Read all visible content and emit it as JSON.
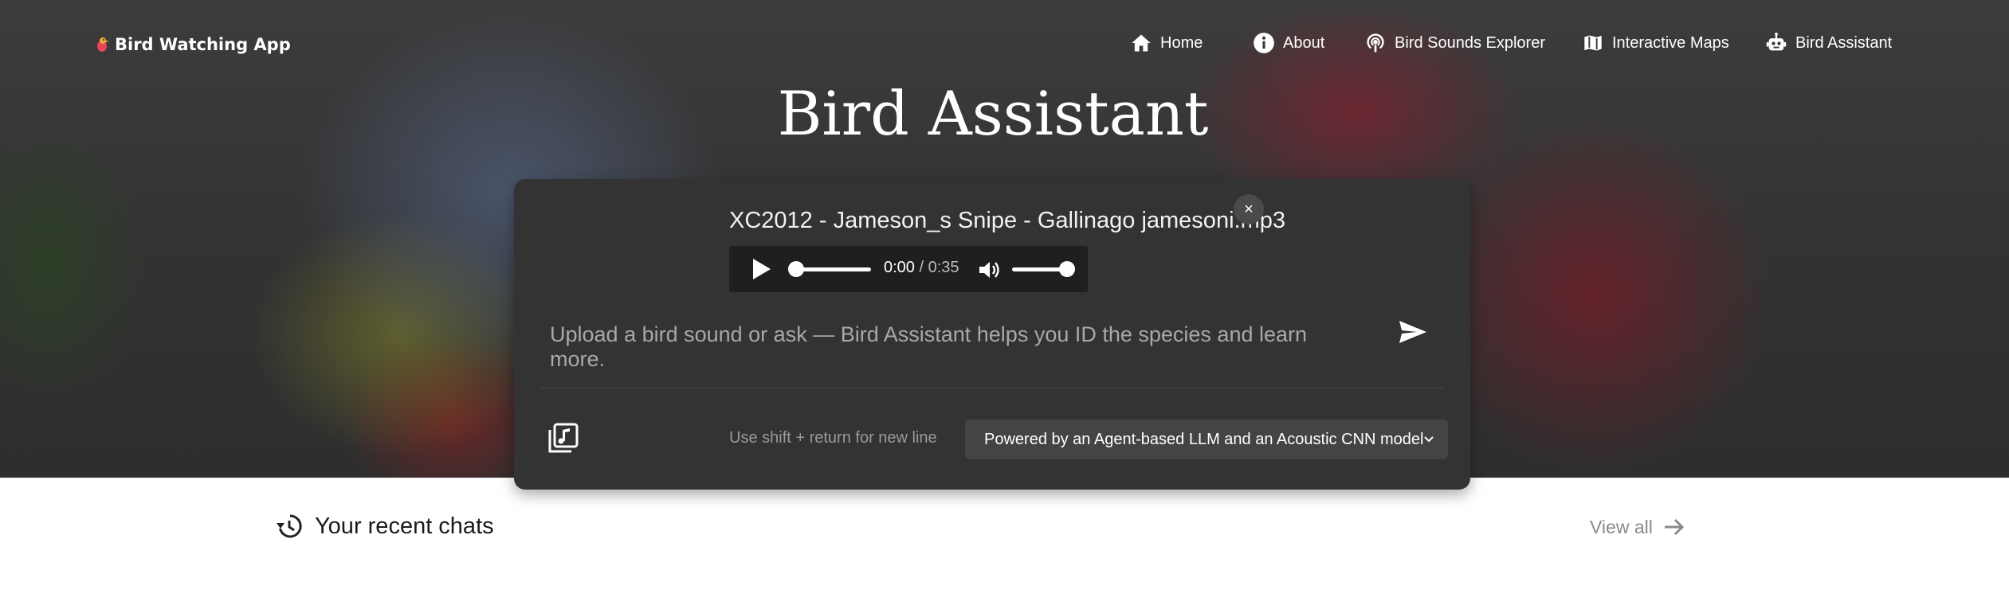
{
  "brand": {
    "name": "Bird Watching App",
    "icon": "bird-logo-icon"
  },
  "nav": [
    {
      "label": "Home",
      "icon": "home-icon"
    },
    {
      "label": "About",
      "icon": "info-icon"
    },
    {
      "label": "Bird Sounds Explorer",
      "icon": "podcast-icon"
    },
    {
      "label": "Interactive Maps",
      "icon": "map-icon"
    },
    {
      "label": "Bird Assistant",
      "icon": "robot-icon"
    }
  ],
  "page_title": "Bird Assistant",
  "attachment": {
    "file_name": "XC2012 - Jameson_s Snipe - Gallinago jamesoni.mp3",
    "close_label": "×",
    "current_time": "0:00",
    "duration": "/ 0:35",
    "progress": 0,
    "volume": 1.0
  },
  "chat_input": {
    "placeholder": "Upload a bird sound or ask — Bird Assistant helps you ID the species and learn more."
  },
  "footer_bar": {
    "hint": "Use shift + return for new line",
    "model_select": "Powered by an Agent-based LLM and an Acoustic CNN model"
  },
  "recent": {
    "title": "Your recent chats",
    "view_all": "View all"
  },
  "colors": {
    "panel": "#333333",
    "select": "#444444",
    "text_muted": "#a8a8a8"
  }
}
